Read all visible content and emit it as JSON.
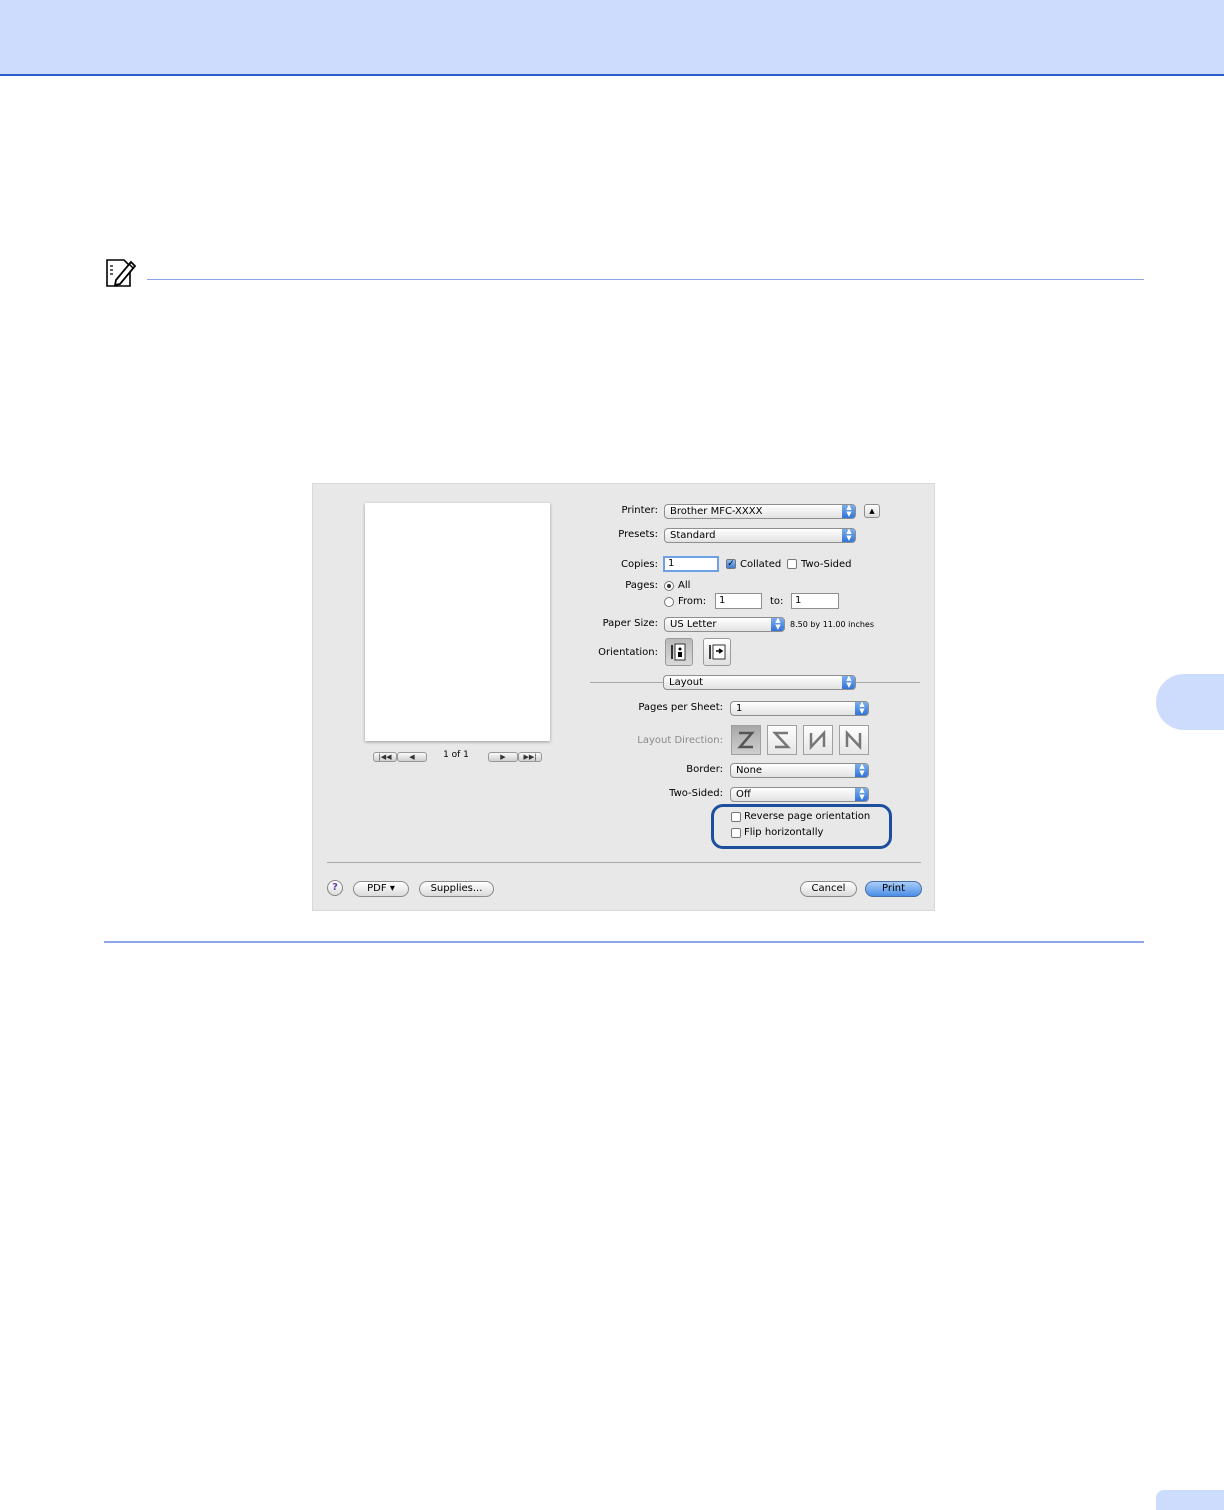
{
  "dialog": {
    "preview": {
      "page_count": "1 of 1"
    },
    "printer": {
      "label": "Printer:",
      "value": "Brother MFC-XXXX"
    },
    "presets": {
      "label": "Presets:",
      "value": "Standard"
    },
    "copies": {
      "label": "Copies:",
      "value": "1",
      "collated_label": "Collated",
      "collated_checked": true,
      "two_sided_label": "Two-Sided",
      "two_sided_checked": false
    },
    "pages": {
      "label": "Pages:",
      "all_label": "All",
      "from_label": "From:",
      "from_value": "1",
      "to_label": "to:",
      "to_value": "1"
    },
    "paper_size": {
      "label": "Paper Size:",
      "value": "US Letter",
      "dimensions": "8.50 by 11.00 inches"
    },
    "orientation": {
      "label": "Orientation:"
    },
    "section": {
      "value": "Layout"
    },
    "pages_per_sheet": {
      "label": "Pages per Sheet:",
      "value": "1"
    },
    "layout_direction": {
      "label": "Layout Direction:"
    },
    "border": {
      "label": "Border:",
      "value": "None"
    },
    "two_sided": {
      "label": "Two-Sided:",
      "value": "Off"
    },
    "reverse_orientation": {
      "label": "Reverse page orientation",
      "checked": false
    },
    "flip_horizontally": {
      "label": "Flip horizontally",
      "checked": false
    },
    "buttons": {
      "help": "?",
      "pdf": "PDF ▾",
      "supplies": "Supplies...",
      "cancel": "Cancel",
      "print": "Print"
    }
  },
  "colors": {
    "header_band": "#cddcfd",
    "header_rule": "#2b5fd0",
    "note_rule": "#8aa6e8",
    "highlight": "#1e4f9c"
  },
  "icons": {
    "note": "pencil-note-icon"
  }
}
